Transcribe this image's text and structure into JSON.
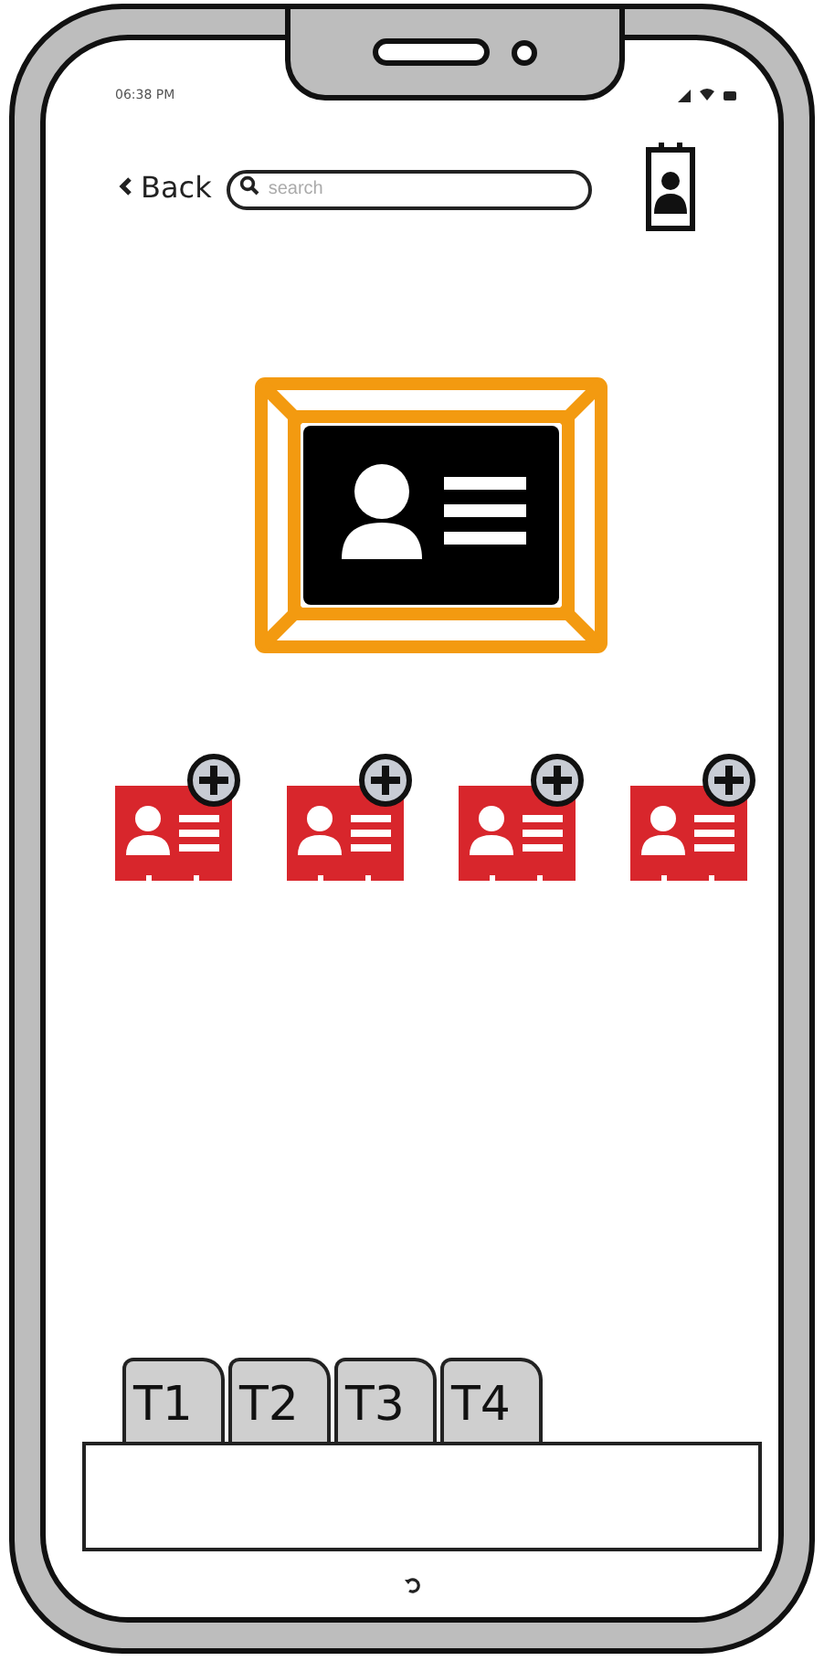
{
  "status_bar": {
    "time": "06:38 PM"
  },
  "header": {
    "back_label": "Back",
    "search": {
      "placeholder": "search"
    }
  },
  "add_cards": [
    {
      "kind": "add"
    },
    {
      "kind": "add"
    },
    {
      "kind": "add"
    },
    {
      "kind": "add"
    }
  ],
  "tabs": [
    {
      "label": "T1"
    },
    {
      "label": "T2"
    },
    {
      "label": "T3"
    },
    {
      "label": "T4"
    }
  ]
}
